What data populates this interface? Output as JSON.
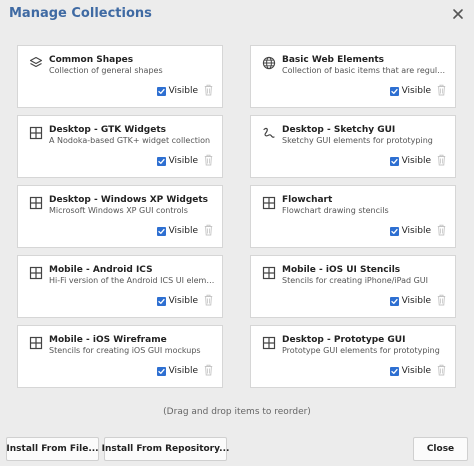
{
  "dialog": {
    "title": "Manage Collections",
    "hint": "(Drag and drop items to reorder)",
    "buttons": {
      "install_file": "Install From File...",
      "install_repo": "Install From Repository...",
      "close": "Close"
    }
  },
  "collections": [
    {
      "title": "Common Shapes",
      "description": "Collection of general shapes",
      "icon": "layers-icon",
      "visible_label": "Visible",
      "visible": true
    },
    {
      "title": "Basic Web Elements",
      "description": "Collection of basic items that are regularly ...",
      "icon": "globe-icon",
      "visible_label": "Visible",
      "visible": true
    },
    {
      "title": "Desktop - GTK Widgets",
      "description": "A Nodoka-based GTK+ widget collection",
      "icon": "grid-icon",
      "visible_label": "Visible",
      "visible": true
    },
    {
      "title": "Desktop - Sketchy GUI",
      "description": "Sketchy GUI elements for prototyping",
      "icon": "squiggle-icon",
      "visible_label": "Visible",
      "visible": true
    },
    {
      "title": "Desktop - Windows XP Widgets",
      "description": "Microsoft Windows XP GUI controls",
      "icon": "grid-icon",
      "visible_label": "Visible",
      "visible": true
    },
    {
      "title": "Flowchart",
      "description": "Flowchart drawing stencils",
      "icon": "grid-icon",
      "visible_label": "Visible",
      "visible": true
    },
    {
      "title": "Mobile - Android ICS",
      "description": "Hi-Fi version of the Android ICS UI elements",
      "icon": "grid-icon",
      "visible_label": "Visible",
      "visible": true
    },
    {
      "title": "Mobile - iOS UI Stencils",
      "description": "Stencils for creating iPhone/iPad GUI",
      "icon": "grid-icon",
      "visible_label": "Visible",
      "visible": true
    },
    {
      "title": "Mobile - iOS Wireframe",
      "description": "Stencils for creating iOS GUI mockups",
      "icon": "grid-icon",
      "visible_label": "Visible",
      "visible": true
    },
    {
      "title": "Desktop - Prototype GUI",
      "description": "Prototype GUI elements for prototyping",
      "icon": "grid-icon",
      "visible_label": "Visible",
      "visible": true
    }
  ],
  "colors": {
    "title": "#3f6aa3",
    "checkbox": "#2e6fd1"
  }
}
